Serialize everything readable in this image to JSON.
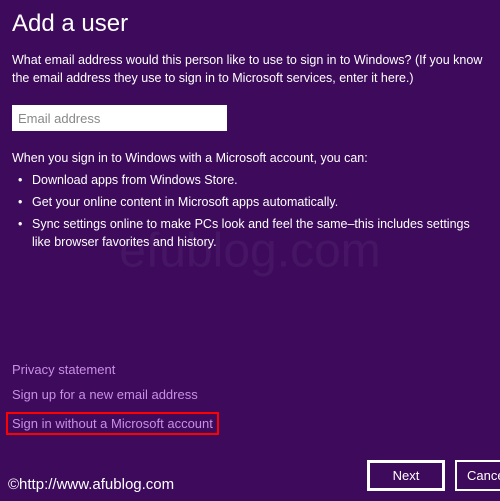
{
  "title": "Add a user",
  "intro": "What email address would this person like to use to sign in to Windows? (If you know the email address they use to sign in to Microsoft services, enter it here.)",
  "email": {
    "placeholder": "Email address",
    "value": ""
  },
  "benefits_intro": "When you sign in to Windows with a Microsoft account, you can:",
  "benefits": [
    "Download apps from Windows Store.",
    "Get your online content in Microsoft apps automatically.",
    "Sync settings online to make PCs look and feel the same–this includes settings like browser favorites and history."
  ],
  "links": {
    "privacy": "Privacy statement",
    "signup": "Sign up for a new email address",
    "no_account": "Sign in without a Microsoft account"
  },
  "buttons": {
    "next": "Next",
    "cancel": "Cancel"
  },
  "footer": "©http://www.afublog.com",
  "watermark": "efublog.com"
}
